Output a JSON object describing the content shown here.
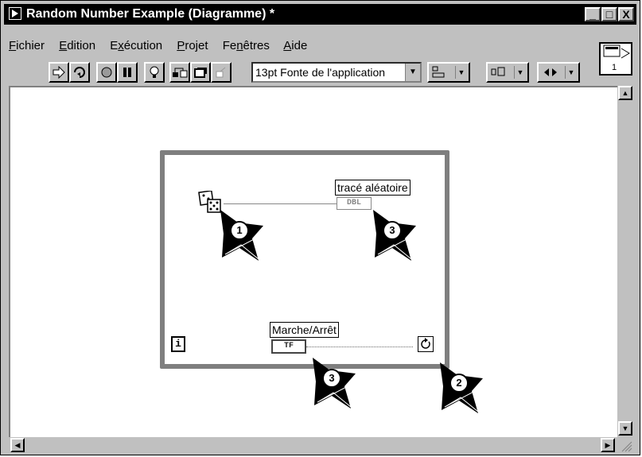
{
  "window": {
    "title": "Random Number Example (Diagramme) *",
    "controls": {
      "minimize": "_",
      "maximize": "□",
      "close": "X"
    }
  },
  "menu": [
    {
      "label": "Fichier",
      "mnemonic": "F"
    },
    {
      "label": "Edition",
      "mnemonic": "E"
    },
    {
      "label": "Exécution",
      "mnemonic": "x"
    },
    {
      "label": "Projet",
      "mnemonic": "P"
    },
    {
      "label": "Fenêtres",
      "mnemonic": "n"
    },
    {
      "label": "Aide",
      "mnemonic": "A"
    }
  ],
  "toolbar": {
    "font_select": "13pt Fonte de l'application"
  },
  "context_help": {
    "number": "1"
  },
  "diagram": {
    "random_plot_label": "tracé aléatoire",
    "random_plot_terminal": "DBL",
    "stop_label": "Marche/Arrêt",
    "stop_terminal": "TF",
    "iteration_terminal": "i"
  },
  "callouts": [
    "1",
    "2",
    "3",
    "3"
  ]
}
